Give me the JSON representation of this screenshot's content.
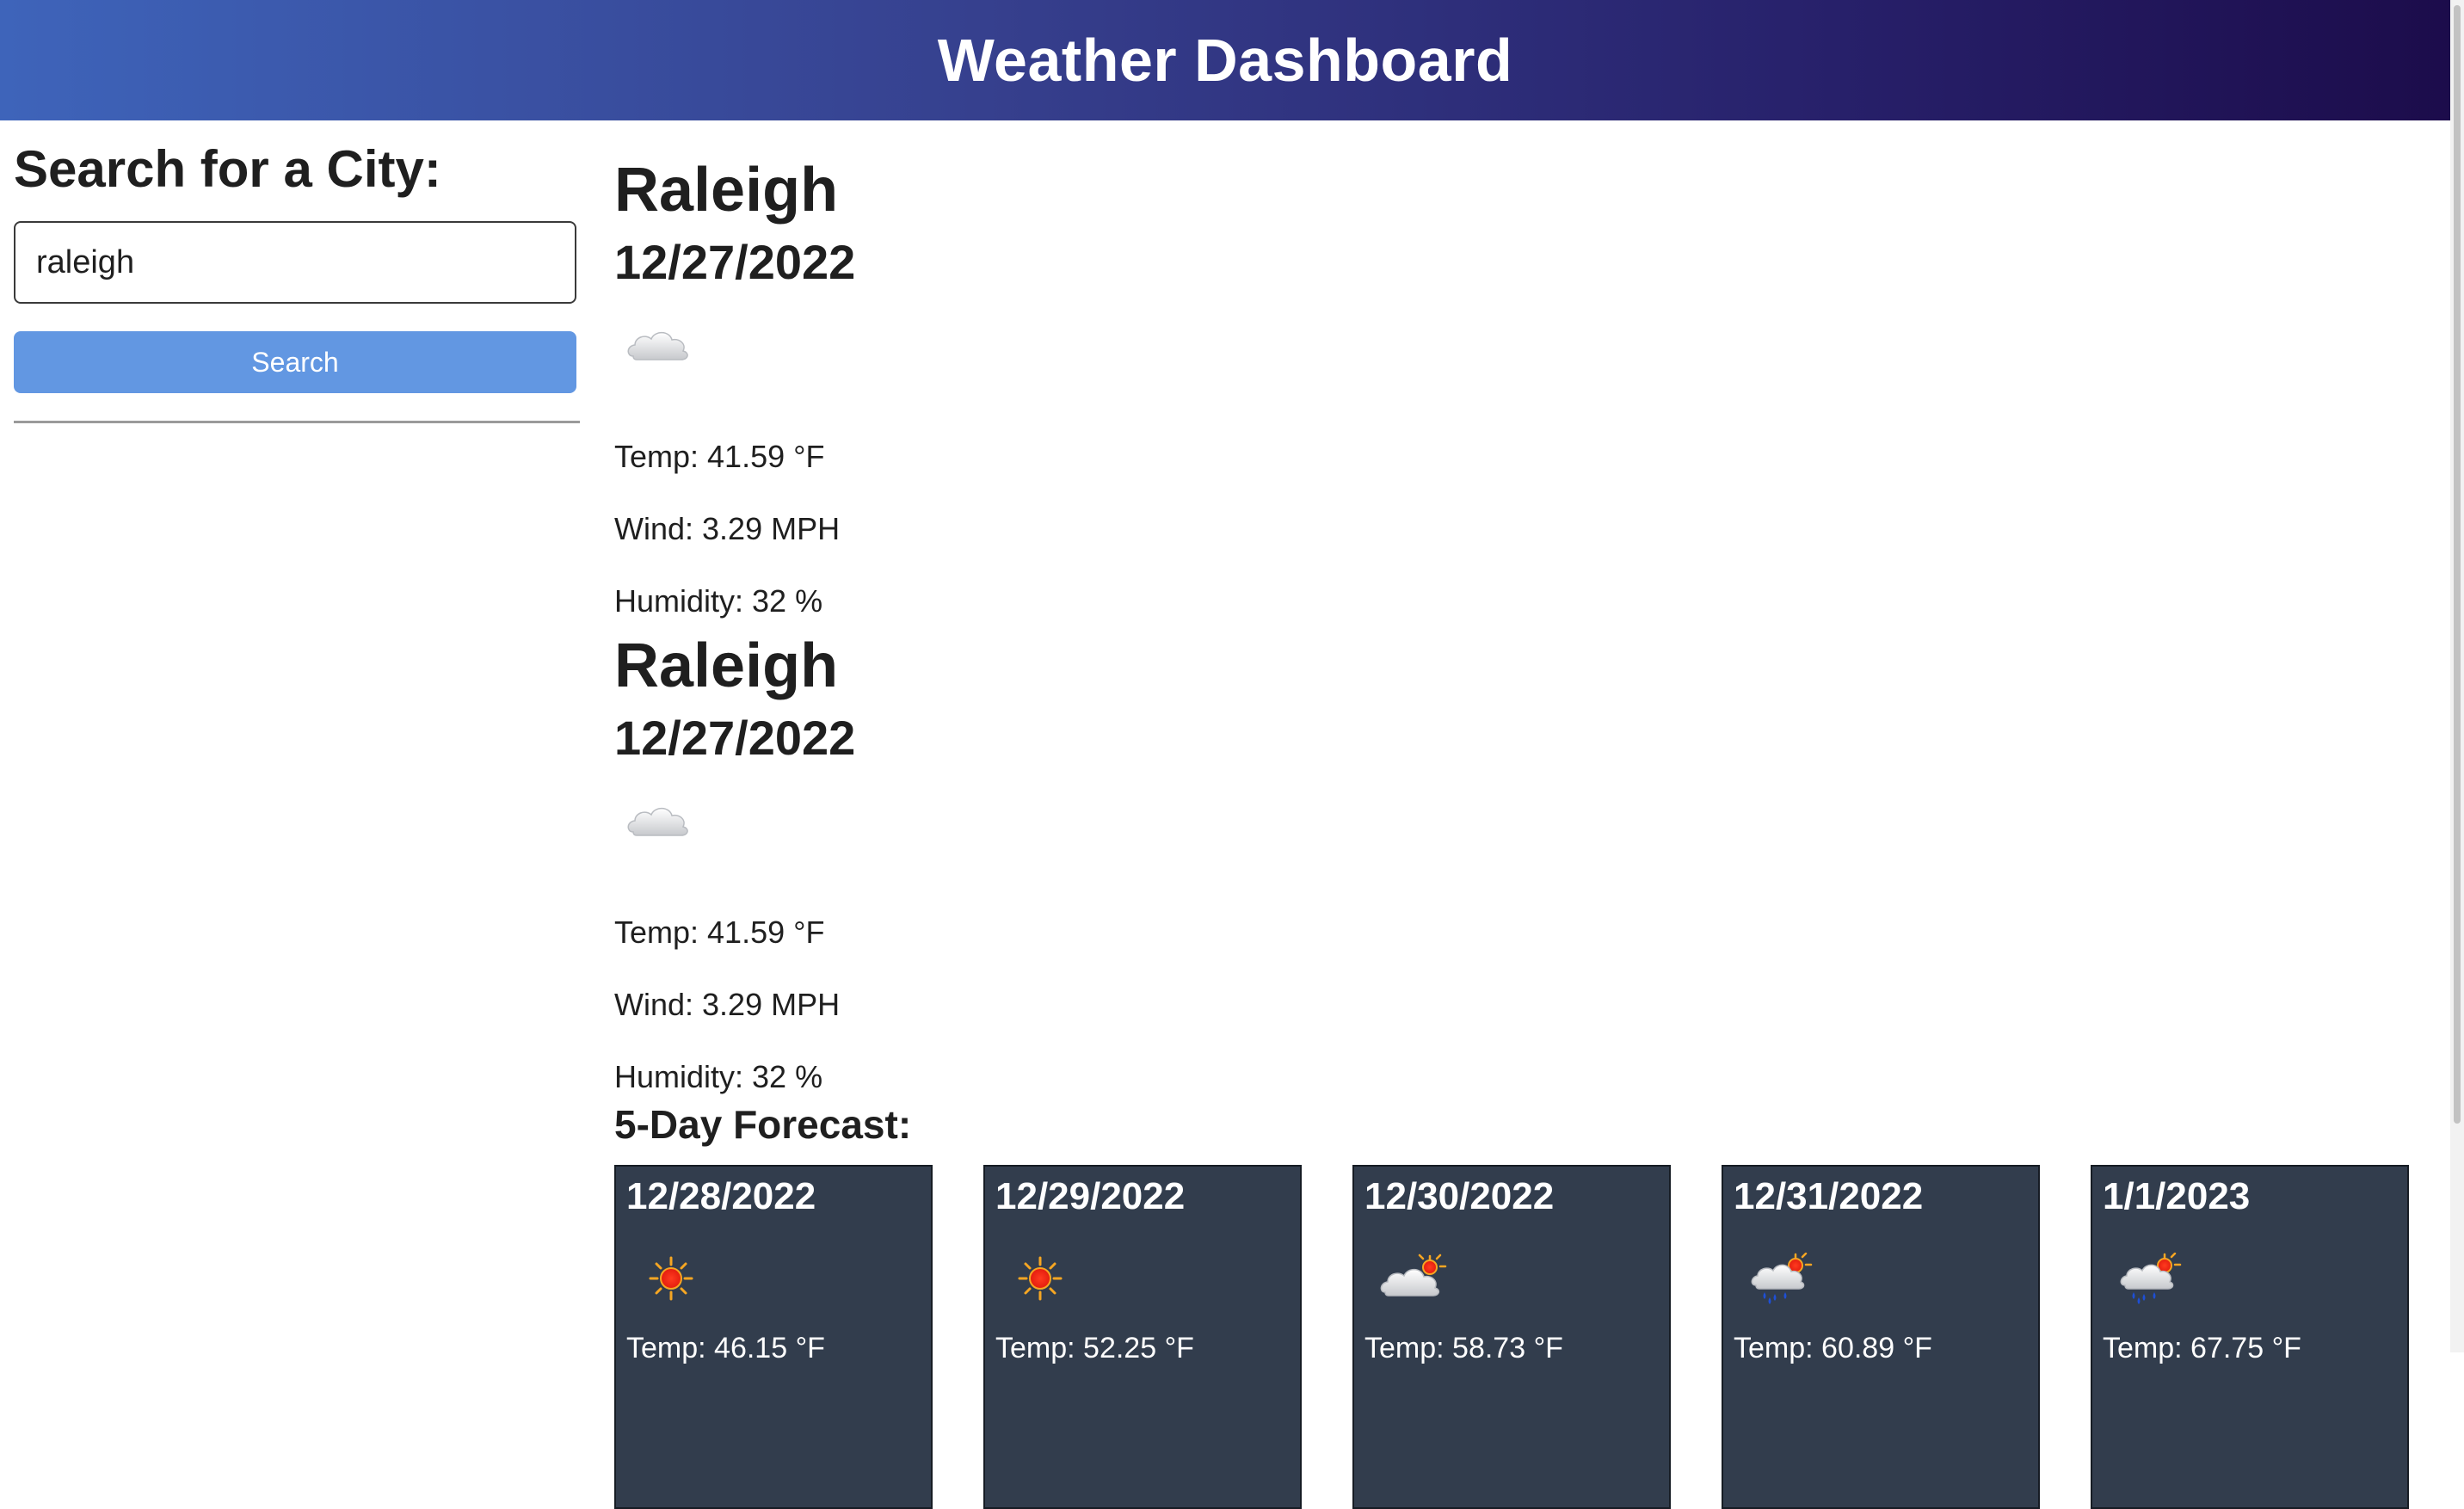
{
  "header": {
    "title": "Weather Dashboard"
  },
  "sidebar": {
    "heading": "Search for a City:",
    "input_value": "raleigh",
    "button_label": "Search"
  },
  "current": [
    {
      "city": "Raleigh",
      "date": "12/27/2022",
      "icon": "cloud-icon",
      "temp": "Temp: 41.59 °F",
      "wind": "Wind: 3.29 MPH",
      "humidity": "Humidity: 32 %"
    },
    {
      "city": "Raleigh",
      "date": "12/27/2022",
      "icon": "cloud-icon",
      "temp": "Temp: 41.59 °F",
      "wind": "Wind: 3.29 MPH",
      "humidity": "Humidity: 32 %"
    }
  ],
  "forecast": {
    "title": "5-Day Forecast:",
    "days": [
      {
        "date": "12/28/2022",
        "icon": "sun-icon",
        "temp": "Temp: 46.15 °F"
      },
      {
        "date": "12/29/2022",
        "icon": "sun-icon",
        "temp": "Temp: 52.25 °F"
      },
      {
        "date": "12/30/2022",
        "icon": "sun-behind-cloud-icon",
        "temp": "Temp: 58.73 °F"
      },
      {
        "date": "12/31/2022",
        "icon": "rain-cloud-sun-icon",
        "temp": "Temp: 60.89 °F"
      },
      {
        "date": "1/1/2023",
        "icon": "rain-cloud-sun-icon",
        "temp": "Temp: 67.75 °F"
      }
    ]
  },
  "colors": {
    "header_gradient_start": "#3e64ba",
    "header_gradient_end": "#1c0c4b",
    "button": "#6297e2",
    "card_background": "#323d4d"
  }
}
